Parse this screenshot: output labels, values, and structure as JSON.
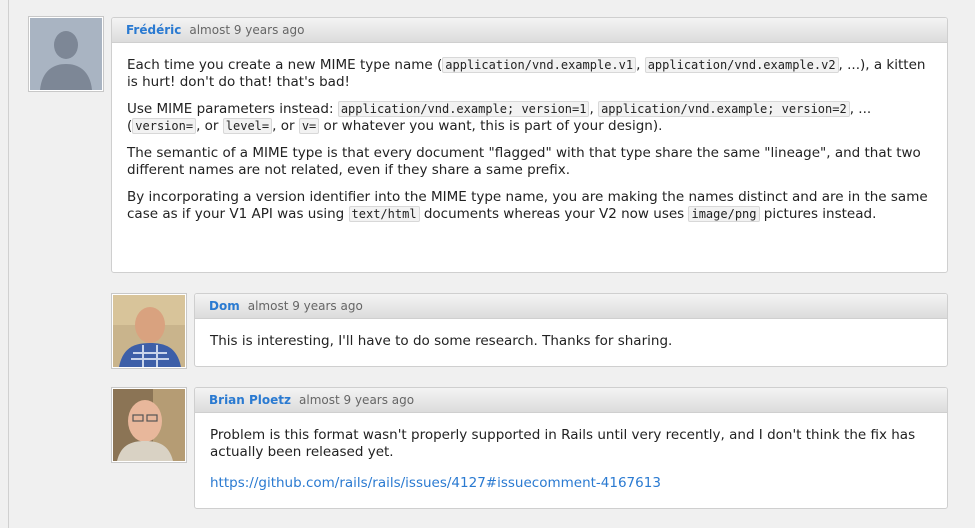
{
  "comments": [
    {
      "author": "Frédéric",
      "time": "almost 9 years ago",
      "p1": {
        "t1": "Each time you create a new MIME type name (",
        "c1": "application/vnd.example.v1",
        "t2": ", ",
        "c2": "application/vnd.example.v2",
        "t3": ", ...), a kitten is hurt! don't do that! that's bad!"
      },
      "p2": {
        "t1": "Use MIME parameters instead: ",
        "c1": "application/vnd.example; version=1",
        "t2": ", ",
        "c2": "application/vnd.example; version=2",
        "t3": ", ... (",
        "c3": "version=",
        "t4": ", or ",
        "c4": "level=",
        "t5": ", or ",
        "c5": "v=",
        "t6": " or whatever you want, this is part of your design)."
      },
      "p3": "The semantic of a MIME type is that every document \"flagged\" with that type share the same \"lineage\", and that two different names are not related, even if they share a same prefix.",
      "p4": {
        "t1": "By incorporating a version identifier into the MIME type name, you are making the names distinct and are in the same case as if your V1 API was using ",
        "c1": "text/html",
        "t2": " documents whereas your V2 now uses ",
        "c2": "image/png",
        "t3": " pictures instead."
      }
    },
    {
      "author": "Dom",
      "time": "almost 9 years ago",
      "text": "This is interesting, I'll have to do some research. Thanks for sharing."
    },
    {
      "author": "Brian Ploetz",
      "time": "almost 9 years ago",
      "text": "Problem is this format wasn't properly supported in Rails until very recently, and I don't think the fix has actually been released yet.",
      "link": "https://github.com/rails/rails/issues/4127#issuecomment-4167613"
    }
  ],
  "colors": {
    "author": "#2a7ad1",
    "link": "#2a7ad1"
  }
}
